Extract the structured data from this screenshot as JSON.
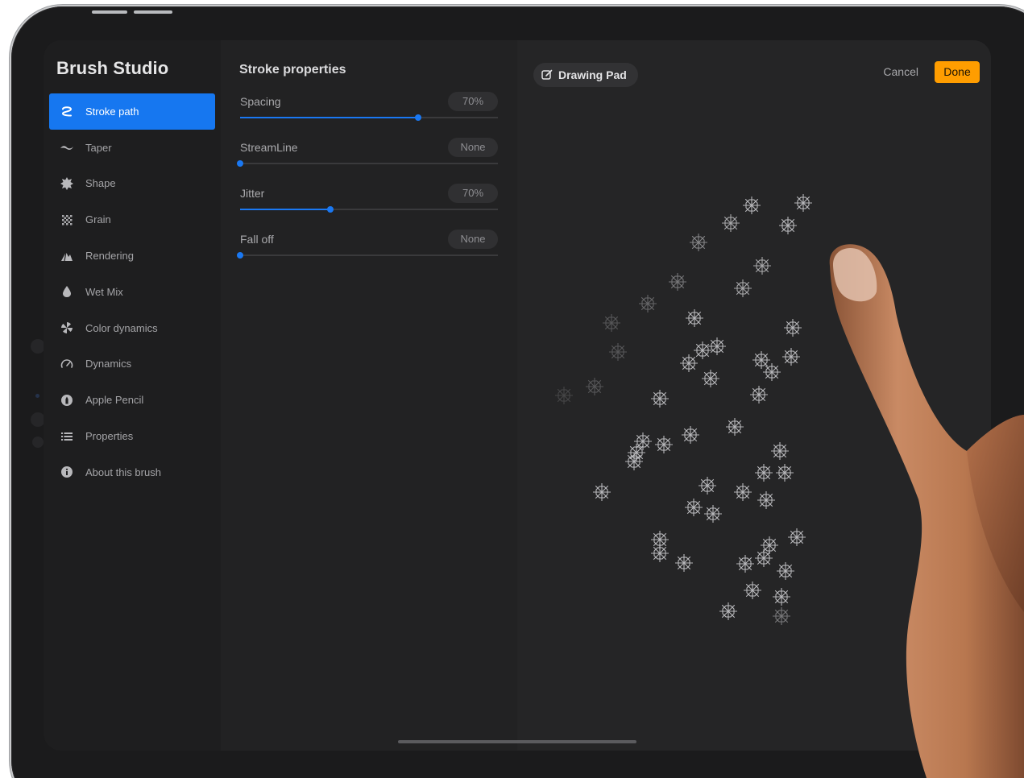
{
  "sidebar": {
    "title": "Brush Studio",
    "items": [
      {
        "label": "Stroke path",
        "icon": "stroke-path-icon",
        "active": true
      },
      {
        "label": "Taper",
        "icon": "taper-icon"
      },
      {
        "label": "Shape",
        "icon": "shape-icon"
      },
      {
        "label": "Grain",
        "icon": "grain-icon"
      },
      {
        "label": "Rendering",
        "icon": "rendering-icon"
      },
      {
        "label": "Wet Mix",
        "icon": "wet-mix-icon"
      },
      {
        "label": "Color dynamics",
        "icon": "color-dynamics-icon"
      },
      {
        "label": "Dynamics",
        "icon": "dynamics-icon"
      },
      {
        "label": "Apple Pencil",
        "icon": "apple-pencil-icon"
      },
      {
        "label": "Properties",
        "icon": "properties-icon"
      },
      {
        "label": "About this brush",
        "icon": "info-icon"
      }
    ]
  },
  "panel": {
    "title": "Stroke properties",
    "sliders": [
      {
        "label": "Spacing",
        "value_text": "70%",
        "level": 0.69
      },
      {
        "label": "StreamLine",
        "value_text": "None",
        "level": 0.0
      },
      {
        "label": "Jitter",
        "value_text": "70%",
        "level": 0.35
      },
      {
        "label": "Fall off",
        "value_text": "None",
        "level": 0.0
      }
    ]
  },
  "canvas": {
    "drawing_pad_label": "Drawing Pad",
    "cancel_label": "Cancel",
    "done_label": "Done",
    "brush_preview": "snowflake-stamp-strokes"
  },
  "colors": {
    "accent_blue": "#1677f0",
    "done_orange": "#ff9d00",
    "screen_bg": "#232324"
  }
}
